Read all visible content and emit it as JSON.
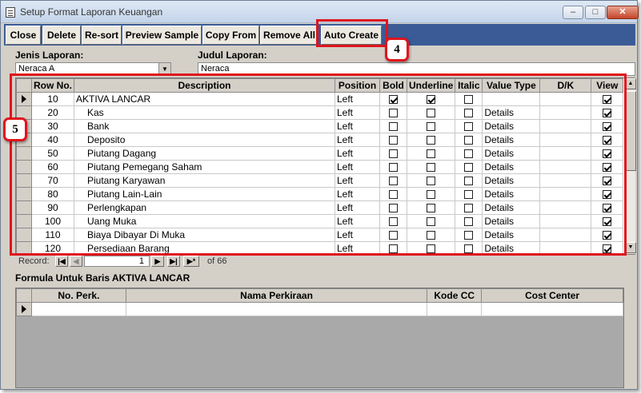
{
  "window": {
    "title": "Setup Format Laporan Keuangan",
    "controls": {
      "minimize": "–",
      "maximize": "□",
      "close": "✕"
    }
  },
  "toolbar": {
    "buttons": [
      {
        "label": "Close"
      },
      {
        "label": "Delete"
      },
      {
        "label": "Re-sort"
      },
      {
        "label": "Preview Sample"
      },
      {
        "label": "Copy From"
      },
      {
        "label": "Remove All"
      },
      {
        "label": "Auto Create"
      }
    ]
  },
  "form": {
    "jenis_label": "Jenis Laporan:",
    "jenis_value": "Neraca A",
    "judul_label": "Judul Laporan:",
    "judul_value": "Neraca"
  },
  "grid": {
    "columns": [
      "Row No.",
      "Description",
      "Position",
      "Bold",
      "Underline",
      "Italic",
      "Value Type",
      "D/K",
      "View"
    ],
    "rows": [
      {
        "row_no": "10",
        "description": "AKTIVA LANCAR",
        "position": "Left",
        "bold": true,
        "underline": true,
        "italic": false,
        "value_type": "",
        "dk": "",
        "view": true,
        "indent": false
      },
      {
        "row_no": "20",
        "description": "Kas",
        "position": "Left",
        "bold": false,
        "underline": false,
        "italic": false,
        "value_type": "Details",
        "dk": "",
        "view": true,
        "indent": true
      },
      {
        "row_no": "30",
        "description": "Bank",
        "position": "Left",
        "bold": false,
        "underline": false,
        "italic": false,
        "value_type": "Details",
        "dk": "",
        "view": true,
        "indent": true
      },
      {
        "row_no": "40",
        "description": "Deposito",
        "position": "Left",
        "bold": false,
        "underline": false,
        "italic": false,
        "value_type": "Details",
        "dk": "",
        "view": true,
        "indent": true
      },
      {
        "row_no": "50",
        "description": "Piutang Dagang",
        "position": "Left",
        "bold": false,
        "underline": false,
        "italic": false,
        "value_type": "Details",
        "dk": "",
        "view": true,
        "indent": true
      },
      {
        "row_no": "60",
        "description": "Piutang Pemegang Saham",
        "position": "Left",
        "bold": false,
        "underline": false,
        "italic": false,
        "value_type": "Details",
        "dk": "",
        "view": true,
        "indent": true
      },
      {
        "row_no": "70",
        "description": "Piutang Karyawan",
        "position": "Left",
        "bold": false,
        "underline": false,
        "italic": false,
        "value_type": "Details",
        "dk": "",
        "view": true,
        "indent": true
      },
      {
        "row_no": "80",
        "description": "Piutang Lain-Lain",
        "position": "Left",
        "bold": false,
        "underline": false,
        "italic": false,
        "value_type": "Details",
        "dk": "",
        "view": true,
        "indent": true
      },
      {
        "row_no": "90",
        "description": "Perlengkapan",
        "position": "Left",
        "bold": false,
        "underline": false,
        "italic": false,
        "value_type": "Details",
        "dk": "",
        "view": true,
        "indent": true
      },
      {
        "row_no": "100",
        "description": "Uang Muka",
        "position": "Left",
        "bold": false,
        "underline": false,
        "italic": false,
        "value_type": "Details",
        "dk": "",
        "view": true,
        "indent": true
      },
      {
        "row_no": "110",
        "description": "Biaya Dibayar Di Muka",
        "position": "Left",
        "bold": false,
        "underline": false,
        "italic": false,
        "value_type": "Details",
        "dk": "",
        "view": true,
        "indent": true
      },
      {
        "row_no": "120",
        "description": "Persediaan Barang",
        "position": "Left",
        "bold": false,
        "underline": false,
        "italic": false,
        "value_type": "Details",
        "dk": "",
        "view": true,
        "indent": true
      }
    ]
  },
  "record_nav": {
    "label": "Record:",
    "current": "1",
    "of_text": "of 66"
  },
  "formula": {
    "title": "Formula Untuk Baris AKTIVA LANCAR",
    "columns": [
      "No. Perk.",
      "Nama Perkiraan",
      "Kode CC",
      "Cost Center"
    ]
  },
  "annotations": {
    "badge_4": "4",
    "badge_5": "5",
    "color": "#e0141c"
  }
}
